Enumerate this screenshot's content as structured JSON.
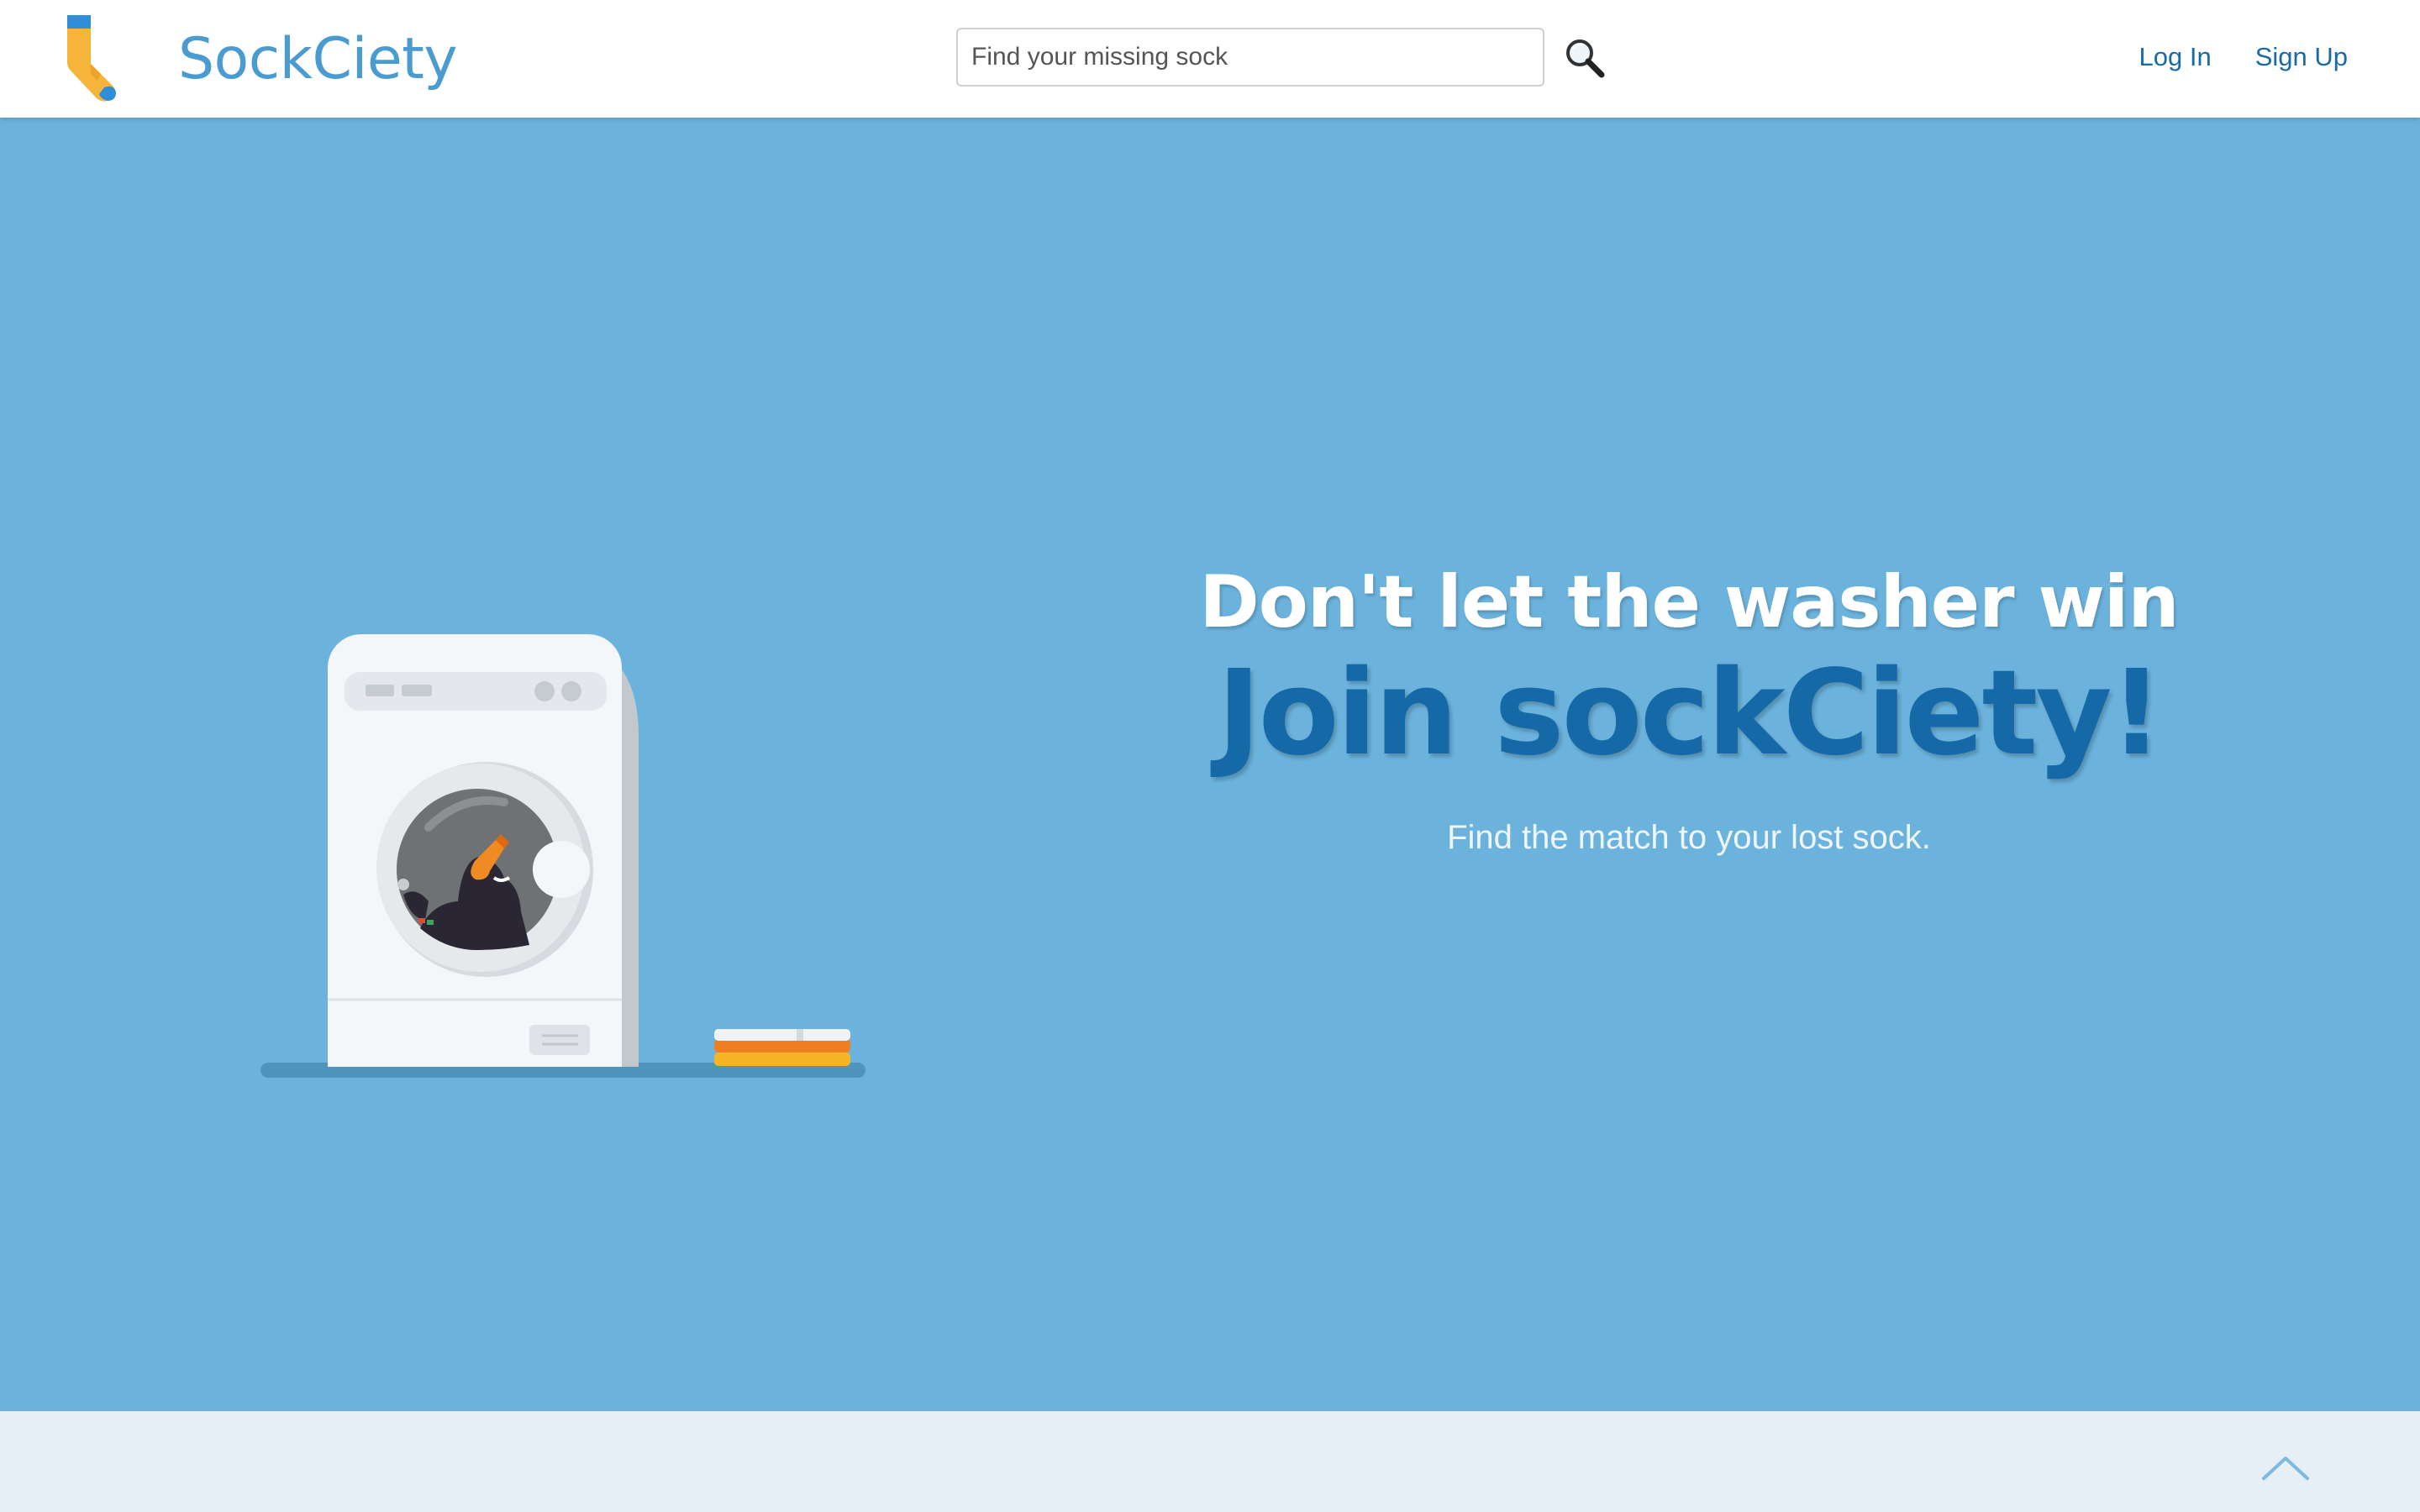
{
  "header": {
    "brand_name": "SockCiety",
    "search": {
      "placeholder": "Find your missing sock",
      "value": ""
    },
    "nav": {
      "login_label": "Log In",
      "signup_label": "Sign Up"
    }
  },
  "hero": {
    "tagline": "Don't let the washer win",
    "headline": "Join sockCiety!",
    "subtext": "Find the match to your lost sock."
  },
  "icons": {
    "logo": "sock-icon",
    "search": "magnifier-icon",
    "back_to_top": "chevron-up-icon"
  },
  "colors": {
    "brand": "#4a9bd0",
    "hero_bg": "#6bb3dd",
    "headline": "#1569a6",
    "link": "#1a6aa6",
    "footer_bg": "#e6eff6"
  }
}
